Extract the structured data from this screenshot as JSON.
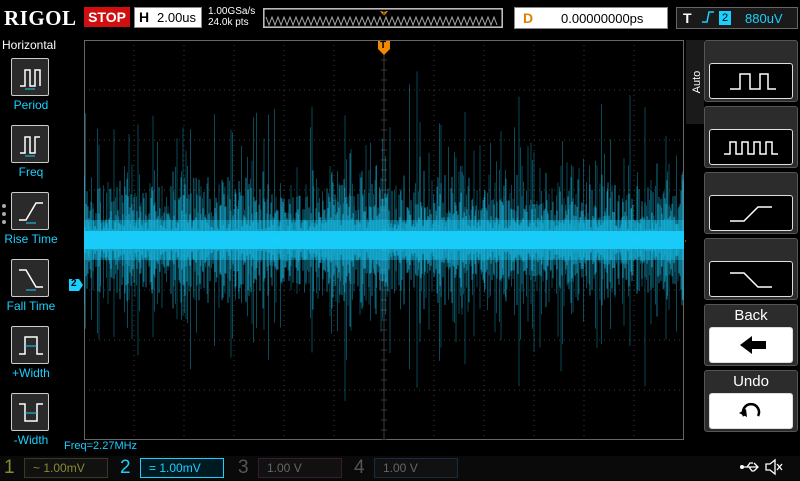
{
  "top": {
    "brand": "RIGOL",
    "run_status": "STOP",
    "horizontal_label": "H",
    "timebase": "2.00us",
    "sample_rate": "1.00GSa/s",
    "memory_depth": "24.0k pts",
    "trigger_marker": "T",
    "delay_label": "D",
    "delay_value": "0.00000000ps",
    "trigger_label": "T",
    "trigger_edge": "rising-edge-icon",
    "trigger_source": "2",
    "trigger_level": "880uV"
  },
  "left_menu": {
    "title": "Horizontal",
    "items": [
      {
        "label": "Period",
        "icon": "period-icon"
      },
      {
        "label": "Freq",
        "icon": "freq-icon"
      },
      {
        "label": "Rise Time",
        "icon": "rise-time-icon"
      },
      {
        "label": "Fall Time",
        "icon": "fall-time-icon"
      },
      {
        "label": "+Width",
        "icon": "positive-width-icon"
      },
      {
        "label": "-Width",
        "icon": "negative-width-icon"
      }
    ]
  },
  "measurement": {
    "freq_readout": "Freq=2.27MHz"
  },
  "markers": {
    "trigger_pos": "T",
    "trigger_level": "T",
    "channel2_ground": "2"
  },
  "right_menu": {
    "auto_label": "Auto",
    "buttons": [
      {
        "icon": "single-pulse-icon"
      },
      {
        "icon": "pulse-train-icon"
      },
      {
        "icon": "rising-edge-icon"
      },
      {
        "icon": "falling-edge-icon"
      },
      {
        "label": "Back",
        "icon": "back-arrow-icon"
      },
      {
        "label": "Undo",
        "icon": "undo-icon"
      }
    ]
  },
  "channels": [
    {
      "num": "1",
      "coupling": "~",
      "scale": "1.00mV",
      "color": "#8a8a30",
      "active": false
    },
    {
      "num": "2",
      "coupling": "=",
      "scale": "1.00mV",
      "color": "#19d0ff",
      "active": true
    },
    {
      "num": "3",
      "coupling": "",
      "scale": "1.00 V",
      "color": "#b0208f",
      "active": false
    },
    {
      "num": "4",
      "coupling": "",
      "scale": "1.00 V",
      "color": "#2060d0",
      "active": false
    }
  ],
  "colors": {
    "accent_cyan": "#19d0ff",
    "trigger_orange": "#f08a00",
    "stop_red": "#d01010",
    "grid": "#3a3a3a"
  }
}
